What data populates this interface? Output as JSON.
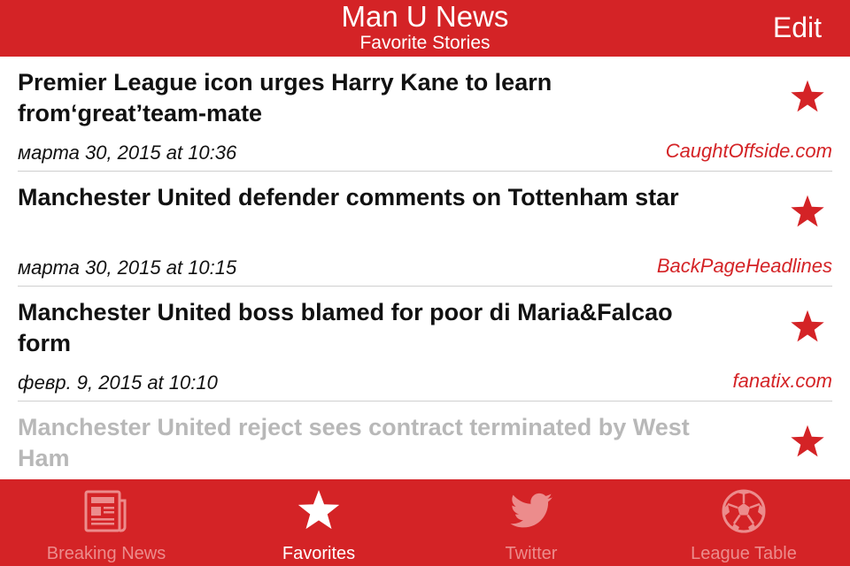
{
  "navbar": {
    "title": "Man U News",
    "subtitle": "Favorite Stories",
    "edit_label": "Edit"
  },
  "stories": [
    {
      "headline": "Premier League icon urges Harry Kane to learn from‘great’team-mate",
      "date": "марта 30, 2015 at 10:36",
      "source": "CaughtOffside.com",
      "favorite_icon": "star-icon"
    },
    {
      "headline": "Manchester United defender comments on Tottenham star",
      "date": "марта 30, 2015 at 10:15",
      "source": "BackPageHeadlines",
      "favorite_icon": "star-icon"
    },
    {
      "headline": "Manchester United boss blamed for poor di Maria&Falcao form",
      "date": "февр. 9, 2015 at 10:10",
      "source": "fanatix.com",
      "favorite_icon": "star-icon"
    },
    {
      "headline": "Manchester United reject sees contract terminated by West Ham",
      "favorite_icon": "star-icon"
    }
  ],
  "tabs": [
    {
      "label": "Breaking News",
      "icon": "newspaper-icon",
      "active": false
    },
    {
      "label": "Favorites",
      "icon": "star-icon",
      "active": true
    },
    {
      "label": "Twitter",
      "icon": "twitter-bird-icon",
      "active": false
    },
    {
      "label": "League Table",
      "icon": "soccer-ball-icon",
      "active": false
    }
  ],
  "colors": {
    "brand_red": "#d42326",
    "inactive_tab": "#ec8c8c",
    "faded_text": "#b8b8b8"
  }
}
